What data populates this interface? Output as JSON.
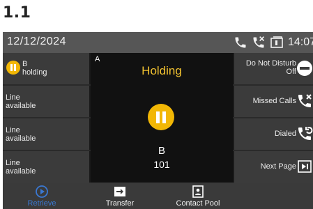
{
  "page": {
    "heading": "1.1"
  },
  "status_bar": {
    "date": "12/12/2024",
    "time": "14:07",
    "icons": [
      "phone-icon",
      "missed-call-icon",
      "voicemail-icon"
    ]
  },
  "line_keys": [
    {
      "line1": "B",
      "line2": "holding",
      "state": "holding"
    },
    {
      "line1": "Line",
      "line2": "available"
    },
    {
      "line1": "Line",
      "line2": "available"
    },
    {
      "line1": "Line",
      "line2": "available"
    }
  ],
  "call_panel": {
    "panel_letter": "A",
    "status": "Holding",
    "caller_name": "B",
    "caller_number": "101"
  },
  "function_keys": [
    {
      "line1": "Do Not Disturb",
      "line2": "Off",
      "icon": "dnd-icon"
    },
    {
      "line1": "Missed Calls",
      "icon": "missed-call-icon"
    },
    {
      "line1": "Dialed",
      "icon": "dialed-call-icon"
    },
    {
      "line1": "Next Page",
      "icon": "next-page-icon"
    }
  ],
  "softkeys": [
    {
      "label": "Retrieve",
      "icon": "play-circle-icon"
    },
    {
      "label": "Transfer",
      "icon": "transfer-icon"
    },
    {
      "label": "Contact Pool",
      "icon": "contacts-icon"
    },
    {
      "label": ""
    }
  ],
  "colors": {
    "hold_accent": "#F2B705",
    "retrieve_accent": "#3A78D2",
    "status_bar": "#565656",
    "key_background": "#3B3B3B",
    "center_background": "#111111"
  }
}
